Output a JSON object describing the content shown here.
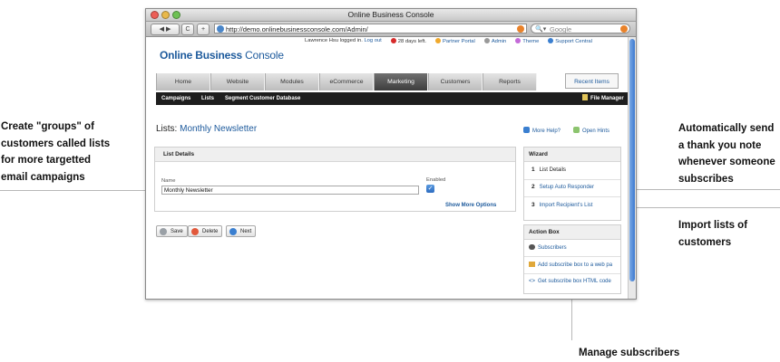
{
  "browser": {
    "window_title": "Online Business Console",
    "url": "http://demo.onlinebusinessconsole.com/Admin/",
    "search_placeholder": "Google",
    "back_label": "◀ ▶",
    "reload_label": "C",
    "add_label": "+"
  },
  "app": {
    "logo_bold": "Online Business",
    "logo_light": " Console",
    "login_text": "Lawrence Hsu logged in.",
    "logout": "Log out",
    "days_left": "28 days left.",
    "partner_portal": "Partner Portal",
    "admin": "Admin",
    "theme": "Theme",
    "support": "Support Central"
  },
  "nav": {
    "tabs": [
      "Home",
      "Website",
      "Modules",
      "eCommerce",
      "Marketing",
      "Customers",
      "Reports"
    ],
    "active": "Marketing",
    "recent_items": "Recent Items"
  },
  "subnav": {
    "items": [
      "Campaigns",
      "Lists",
      "Segment Customer Database"
    ],
    "file_manager": "File Manager"
  },
  "page": {
    "title_prefix": "Lists: ",
    "title_name": "Monthly Newsletter",
    "more_help": "More Help?",
    "open_hints": "Open Hints"
  },
  "list_details": {
    "heading": "List Details",
    "name_label": "Name",
    "name_value": "Monthly Newsletter",
    "enabled_label": "Enabled",
    "enabled": true,
    "show_more": "Show More Options"
  },
  "buttons": {
    "save": "Save",
    "delete": "Delete",
    "next": "Next"
  },
  "wizard": {
    "heading": "Wizard",
    "steps": [
      {
        "num": "1",
        "label": "List Details"
      },
      {
        "num": "2",
        "label": "Setup Auto Responder"
      },
      {
        "num": "3",
        "label": "Import Recipient's List"
      }
    ]
  },
  "action_box": {
    "heading": "Action Box",
    "items": [
      "Subscribers",
      "Add subscribe box to a web pa",
      "Get subscribe box HTML code"
    ]
  },
  "callouts": {
    "left": "Create \"groups\" of\ncustomers called lists\nfor more targetted\nemail campaigns",
    "right_top": "Automatically send\na thank you note\nwhenever someone\nsubscribes",
    "right_mid": "Import lists of\ncustomers",
    "bottom": "Manage subscribers"
  }
}
